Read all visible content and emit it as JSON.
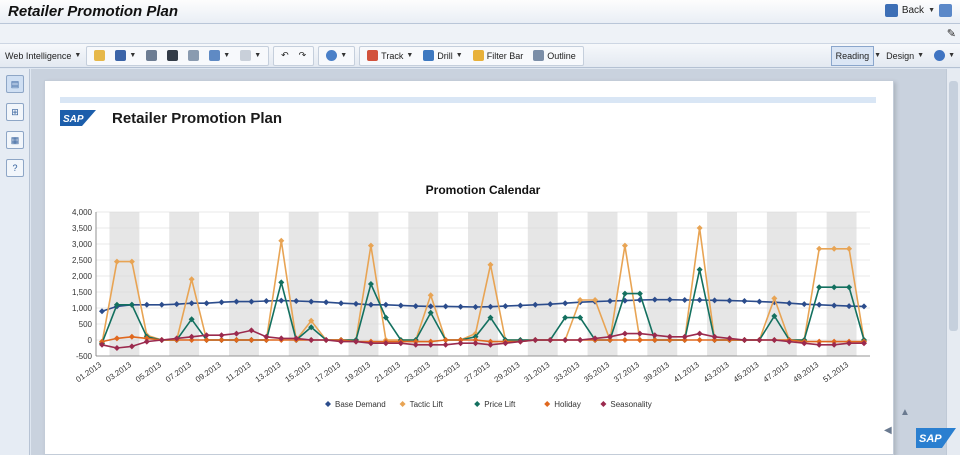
{
  "window": {
    "title": "Retailer Promotion Plan",
    "back_label": "Back"
  },
  "toolbar": {
    "app_menu": "Web Intelligence",
    "track": "Track",
    "drill": "Drill",
    "filter_bar": "Filter Bar",
    "outline": "Outline",
    "reading": "Reading",
    "design": "Design"
  },
  "report": {
    "logo_text": "SAP",
    "title": "Retailer Promotion Plan",
    "corner_logo_text": "SAP"
  },
  "colors": {
    "base_demand": "#2b4c8c",
    "tactic_lift": "#e8a454",
    "price_lift": "#13705f",
    "holiday": "#e0681e",
    "seasonality": "#9b2a4e"
  },
  "chart_data": {
    "type": "line",
    "title": "Promotion Calendar",
    "ylim": [
      -500,
      4000
    ],
    "yticks": [
      -500,
      0,
      500,
      1000,
      1500,
      2000,
      2500,
      3000,
      3500,
      4000
    ],
    "ytick_labels": [
      "-500",
      "0",
      "500",
      "1,000",
      "1,500",
      "2,000",
      "2,500",
      "3,000",
      "3,500",
      "4,000"
    ],
    "xtick_labels": [
      "01.2013",
      "03.2013",
      "05.2013",
      "07.2013",
      "09.2013",
      "11.2013",
      "13.2013",
      "15.2013",
      "17.2013",
      "19.2013",
      "21.2013",
      "23.2013",
      "25.2013",
      "27.2013",
      "29.2013",
      "31.2013",
      "33.2013",
      "35.2013",
      "37.2013",
      "39.2013",
      "41.2013",
      "43.2013",
      "45.2013",
      "47.2013",
      "49.2013",
      "51.2013"
    ],
    "legend_position": "bottom",
    "series": [
      {
        "name": "Base Demand",
        "values": [
          900,
          1050,
          1100,
          1100,
          1100,
          1120,
          1150,
          1150,
          1180,
          1200,
          1200,
          1220,
          1230,
          1220,
          1200,
          1180,
          1150,
          1130,
          1100,
          1100,
          1080,
          1060,
          1050,
          1050,
          1040,
          1030,
          1040,
          1060,
          1080,
          1100,
          1120,
          1150,
          1180,
          1200,
          1220,
          1230,
          1250,
          1260,
          1260,
          1250,
          1250,
          1240,
          1230,
          1220,
          1200,
          1180,
          1150,
          1120,
          1100,
          1080,
          1060,
          1050
        ]
      },
      {
        "name": "Tactic Lift",
        "values": [
          -100,
          2450,
          2450,
          150,
          0,
          0,
          1900,
          0,
          0,
          0,
          0,
          0,
          3100,
          0,
          600,
          0,
          0,
          0,
          2950,
          0,
          0,
          0,
          1400,
          0,
          0,
          200,
          2350,
          0,
          0,
          0,
          0,
          0,
          1250,
          1250,
          0,
          2950,
          0,
          0,
          0,
          0,
          3500,
          0,
          0,
          0,
          0,
          1300,
          0,
          0,
          2850,
          2850,
          2850,
          0
        ]
      },
      {
        "name": "Price Lift",
        "values": [
          -100,
          1100,
          1100,
          100,
          0,
          0,
          650,
          0,
          0,
          0,
          0,
          0,
          1800,
          0,
          400,
          0,
          0,
          0,
          1750,
          700,
          0,
          0,
          850,
          0,
          0,
          100,
          700,
          0,
          0,
          0,
          0,
          700,
          700,
          0,
          0,
          1450,
          1450,
          0,
          0,
          0,
          2200,
          0,
          0,
          0,
          0,
          750,
          0,
          0,
          1650,
          1650,
          1650,
          0
        ]
      },
      {
        "name": "Holiday",
        "values": [
          -50,
          50,
          100,
          50,
          0,
          0,
          0,
          0,
          0,
          0,
          0,
          0,
          0,
          0,
          0,
          0,
          0,
          -50,
          -50,
          -50,
          -50,
          -50,
          -50,
          0,
          0,
          0,
          -50,
          -50,
          -50,
          0,
          0,
          0,
          0,
          0,
          0,
          0,
          0,
          0,
          0,
          0,
          0,
          0,
          0,
          0,
          0,
          0,
          0,
          -50,
          -50,
          -50,
          -50,
          -50
        ]
      },
      {
        "name": "Seasonality",
        "values": [
          -150,
          -250,
          -200,
          -50,
          0,
          50,
          100,
          150,
          150,
          200,
          300,
          100,
          50,
          50,
          0,
          0,
          -50,
          -50,
          -100,
          -100,
          -100,
          -150,
          -150,
          -150,
          -100,
          -100,
          -150,
          -100,
          -50,
          0,
          0,
          0,
          0,
          50,
          100,
          200,
          200,
          150,
          100,
          100,
          200,
          100,
          50,
          0,
          0,
          0,
          -50,
          -100,
          -150,
          -150,
          -100,
          -100
        ]
      }
    ]
  }
}
